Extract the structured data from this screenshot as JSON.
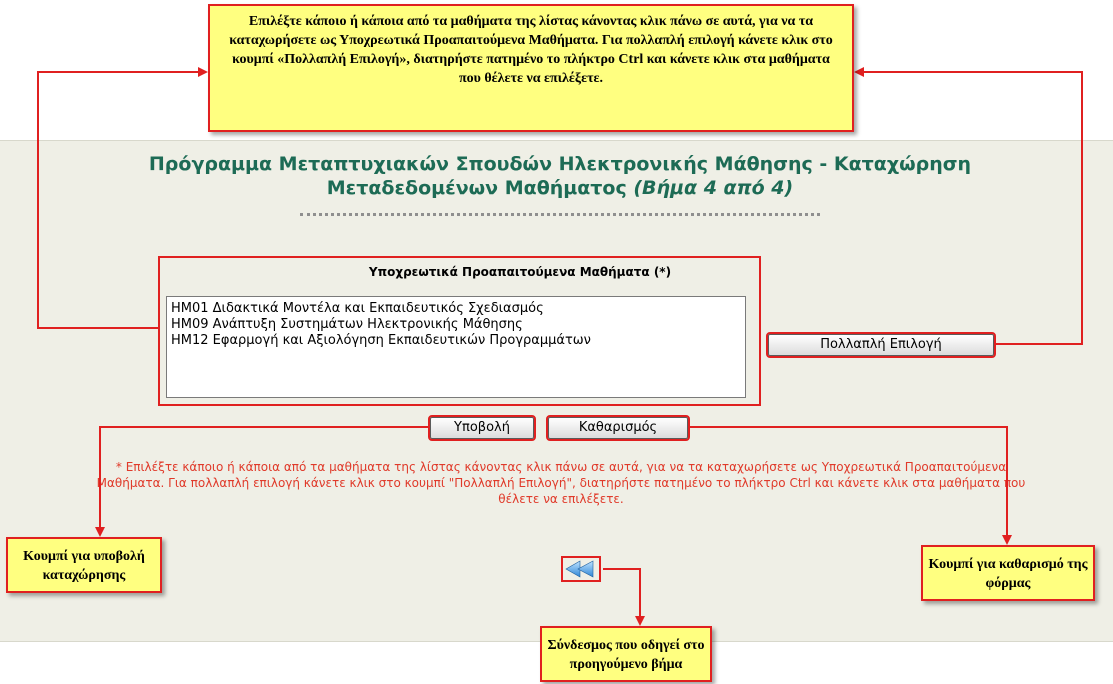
{
  "page": {
    "title_main": "Πρόγραμμα Μεταπτυχιακών Σπουδών Ηλεκτρονικής Μάθησης - Καταχώρηση Μεταδεδομένων Μαθήματος",
    "title_step": "(Βήμα 4 από 4)"
  },
  "form": {
    "field_label": "Υποχρεωτικά Προαπαιτούμενα Μαθήματα (*)",
    "options": [
      "HM01 Διδακτικά Μοντέλα και Εκπαιδευτικός Σχεδιασμός",
      "HM09 Ανάπτυξη Συστημάτων Ηλεκτρονικής Μάθησης",
      "HM12 Εφαρμογή και Αξιολόγηση Εκπαιδευτικών Προγραμμάτων"
    ],
    "multi_select_button": "Πολλαπλή Επιλογή",
    "submit_button": "Υποβολή",
    "clear_button": "Καθαρισμός",
    "note": "* Επιλέξτε κάποιο ή κάποια από τα μαθήματα της λίστας κάνοντας κλικ πάνω σε αυτά, για να τα καταχωρήσετε ως Υποχρεωτικά Προαπαιτούμενα Μαθήματα. Για πολλαπλή επιλογή κάνετε κλικ στο κουμπί \"Πολλαπλή Επιλογή\", διατηρήστε πατημένο το πλήκτρο Ctrl και κάνετε κλικ στα μαθήματα που θέλετε να επιλέξετε."
  },
  "callouts": {
    "top": "Επιλέξτε κάποιο ή κάποια από τα μαθήματα της λίστας κάνοντας κλικ πάνω σε αυτά, για να τα καταχωρήσετε ως Υποχρεωτικά Προαπαιτούμενα Μαθήματα. Για πολλαπλή επιλογή κάνετε κλικ στο κουμπί «Πολλαπλή Επιλογή», διατηρήστε πατημένο το πλήκτρο Ctrl και κάνετε κλικ στα μαθήματα που θέλετε να επιλέξετε.",
    "submit": "Κουμπί για υποβολή καταχώρησης",
    "clear": "Κουμπί για καθαρισμό της φόρμας",
    "back": "Σύνδεσμος που οδηγεί στο προηγούμενο βήμα"
  },
  "icons": {
    "back": "double-left-arrow-icon"
  },
  "colors": {
    "accent": "#e02020",
    "title": "#1d6b55",
    "note": "#e03a2a",
    "callout_bg": "#ffff80"
  }
}
